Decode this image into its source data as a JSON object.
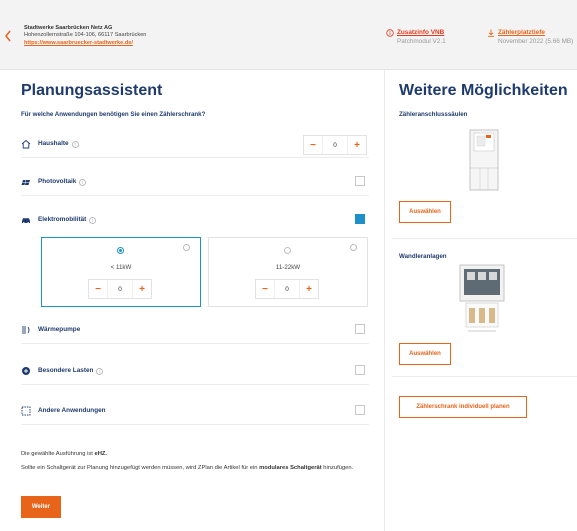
{
  "header": {
    "company_name": "Stadtwerke Saarbrücken Netz AG",
    "company_address": "Hohenzollernstraße 104-106, 66117 Saarbrücken",
    "company_link": "https://www.saarbruecker-stadtwerke.de/",
    "zusatzinfo_title": "Zusatzinfo VNB",
    "zusatzinfo_sub": "Patchmodul V2.1",
    "zaehlerplatz_title": "Zählerplatztiefe",
    "zaehlerplatz_sub": "November 2022 (5.66 MB)"
  },
  "assistant": {
    "title": "Planungsassistent",
    "question": "Für welche Anwendungen benötigen Sie einen Zählerschrank?",
    "rows": [
      {
        "label": "Haushalte",
        "icon": "house-icon"
      },
      {
        "label": "Photovoltaik",
        "icon": "solar-panel-icon"
      },
      {
        "label": "Elektromobilität",
        "icon": "car-icon"
      },
      {
        "label": "Wärmepumpe",
        "icon": "heat-pump-icon"
      },
      {
        "label": "Besondere Lasten",
        "icon": "special-load-icon"
      },
      {
        "label": "Andere Anwendungen",
        "icon": "dashed-square-icon"
      }
    ],
    "haushalte_count": "0",
    "emob_options": [
      {
        "label": "< 11kW",
        "count": "0",
        "selected": true
      },
      {
        "label": "11-22kW",
        "count": "0",
        "selected": false
      }
    ],
    "checked": {
      "photovoltaik": false,
      "elektromobilitaet": true,
      "waermepumpe": false,
      "besondere_lasten": false,
      "andere": false
    },
    "note_line1_prefix": "Die gewählte Ausführung ist ",
    "note_line1_bold": "eHZ.",
    "note_line2_prefix": "Sollte ein Schaltgerät zur Planung hinzugefügt werden müssen, wird ZPlan die Artikel für ein ",
    "note_line2_bold": "modulares Schaltgerät",
    "note_line2_suffix": " hinzufügen.",
    "next_label": "Weiter",
    "minus": "−",
    "plus": "+"
  },
  "options_panel": {
    "title": "Weitere Möglichkeiten",
    "card1_title": "Zähleranschlusssäulen",
    "card1_button": "Auswählen",
    "card2_title": "Wandleranlagen",
    "card2_button": "Auswählen",
    "individual_button": "Zählerschrank individuell planen"
  },
  "colors": {
    "accent": "#e8641b",
    "heading": "#1f3b6e",
    "checkbox_active": "#1e90c8",
    "warning": "#e63a1e"
  }
}
